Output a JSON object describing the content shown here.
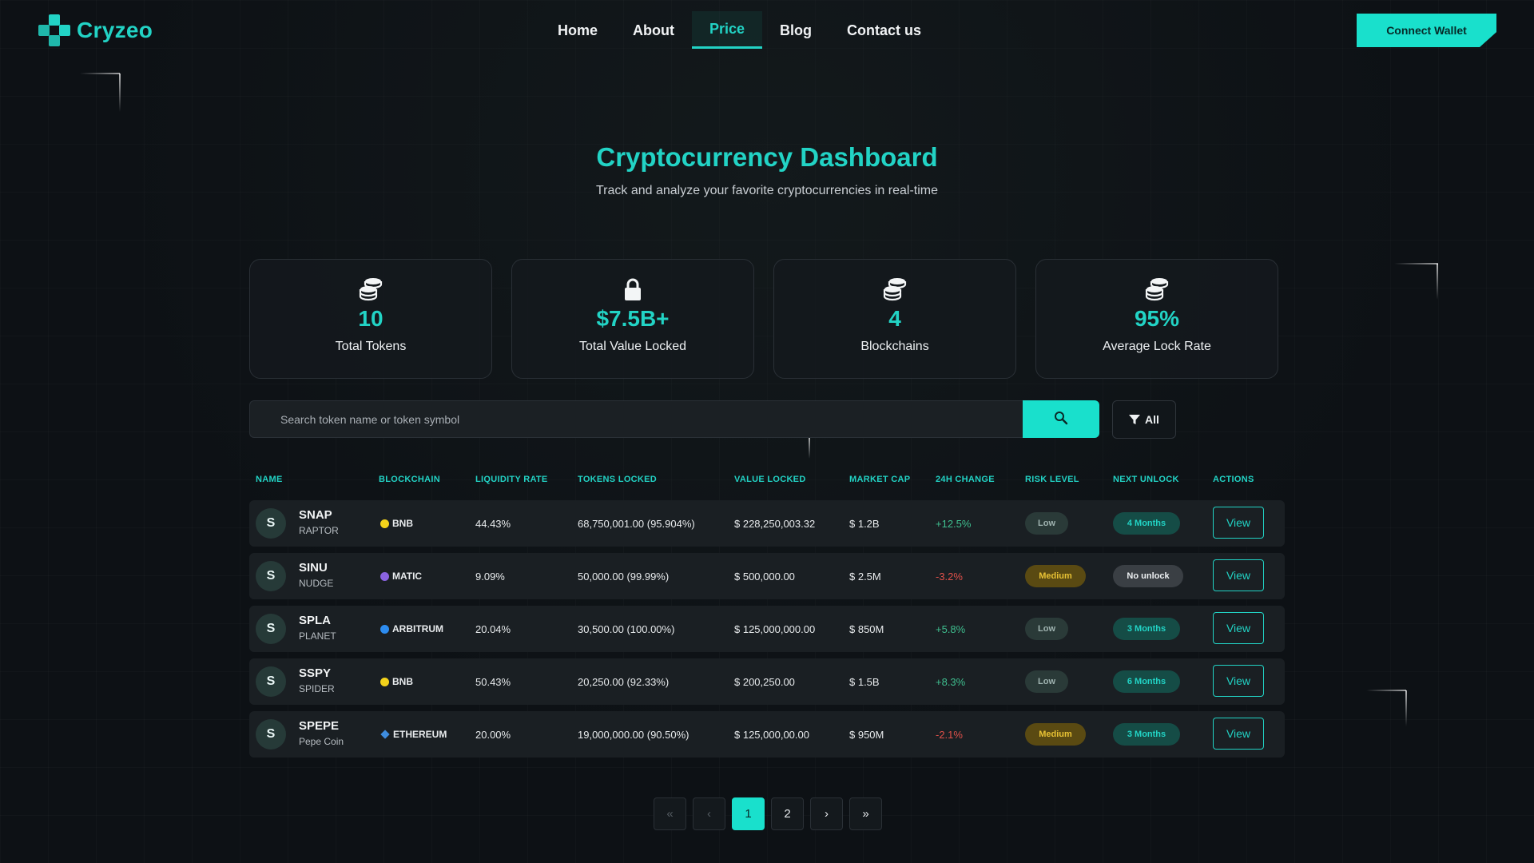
{
  "brand": {
    "name": "Cryzeo",
    "accent": "#22d3c5"
  },
  "nav": [
    {
      "label": "Home",
      "active": false
    },
    {
      "label": "About",
      "active": false
    },
    {
      "label": "Price",
      "active": true
    },
    {
      "label": "Blog",
      "active": false
    },
    {
      "label": "Contact us",
      "active": false
    }
  ],
  "connect_wallet": "Connect Wallet",
  "hero": {
    "title": "Cryptocurrency Dashboard",
    "subtitle": "Track and analyze your favorite cryptocurrencies in real-time"
  },
  "stats": [
    {
      "icon": "coins-icon",
      "value": "10",
      "label": "Total Tokens"
    },
    {
      "icon": "lock-icon",
      "value": "$7.5B+",
      "label": "Total Value Locked"
    },
    {
      "icon": "coins-icon",
      "value": "4",
      "label": "Blockchains"
    },
    {
      "icon": "coins-icon",
      "value": "95%",
      "label": "Average Lock Rate"
    }
  ],
  "search": {
    "placeholder": "Search token name or token symbol",
    "value": ""
  },
  "filter": {
    "label": "All"
  },
  "table": {
    "headers": [
      "NAME",
      "BLOCKCHAIN",
      "LIQUIDITY RATE",
      "TOKENS LOCKED",
      "VALUE LOCKED",
      "MARKET CAP",
      "24H CHANGE",
      "RISK LEVEL",
      "NEXT UNLOCK",
      "ACTIONS"
    ],
    "rows": [
      {
        "avatar": "S",
        "symbol": "SNAP",
        "name": "RAPTOR",
        "chain": "BNB",
        "liquidity": "44.43%",
        "locked": "68,750,001.00 (95.904%)",
        "value": "$ 228,250,003.32",
        "mcap": "$ 1.2B",
        "change": "+12.5%",
        "risk": "Low",
        "unlock": "4 Months",
        "action": "View"
      },
      {
        "avatar": "S",
        "symbol": "SINU",
        "name": "NUDGE",
        "chain": "MATIC",
        "liquidity": "9.09%",
        "locked": "50,000.00 (99.99%)",
        "value": "$ 500,000.00",
        "mcap": "$ 2.5M",
        "change": "-3.2%",
        "risk": "Medium",
        "unlock": "No unlock",
        "action": "View"
      },
      {
        "avatar": "S",
        "symbol": "SPLA",
        "name": "PLANET",
        "chain": "ARBITRUM",
        "liquidity": "20.04%",
        "locked": "30,500.00 (100.00%)",
        "value": "$ 125,000,000.00",
        "mcap": "$ 850M",
        "change": "+5.8%",
        "risk": "Low",
        "unlock": "3 Months",
        "action": "View"
      },
      {
        "avatar": "S",
        "symbol": "SSPY",
        "name": "SPIDER",
        "chain": "BNB",
        "liquidity": "50.43%",
        "locked": "20,250.00 (92.33%)",
        "value": "$ 200,250.00",
        "mcap": "$ 1.5B",
        "change": "+8.3%",
        "risk": "Low",
        "unlock": "6 Months",
        "action": "View"
      },
      {
        "avatar": "S",
        "symbol": "SPEPE",
        "name": "Pepe Coin",
        "chain": "ETHEREUM",
        "liquidity": "20.00%",
        "locked": "19,000,000.00 (90.50%)",
        "value": "$ 125,000,00.00",
        "mcap": "$ 950M",
        "change": "-2.1%",
        "risk": "Medium",
        "unlock": "3 Months",
        "action": "View"
      }
    ]
  },
  "chain_colors": {
    "BNB": "#f3d21b",
    "MATIC": "#8a63e0",
    "ARBITRUM": "#2d8cf0",
    "ETHEREUM": "#3e8de0"
  },
  "colors": {
    "positive": "#3fbf8f",
    "negative": "#e0504a",
    "risk_low_bg": "#2a3a38",
    "risk_low_fg": "#9fb3b0",
    "risk_medium_bg": "#5a4a12",
    "risk_medium_fg": "#e8c234",
    "unlock_bg": "#154c46",
    "unlock_fg": "#22d3c5",
    "no_unlock_bg": "#3a3f44",
    "no_unlock_fg": "#eef1f3"
  },
  "pagination": {
    "first": "«",
    "prev": "‹",
    "pages": [
      "1",
      "2"
    ],
    "current": "1",
    "next": "›",
    "last": "»"
  }
}
